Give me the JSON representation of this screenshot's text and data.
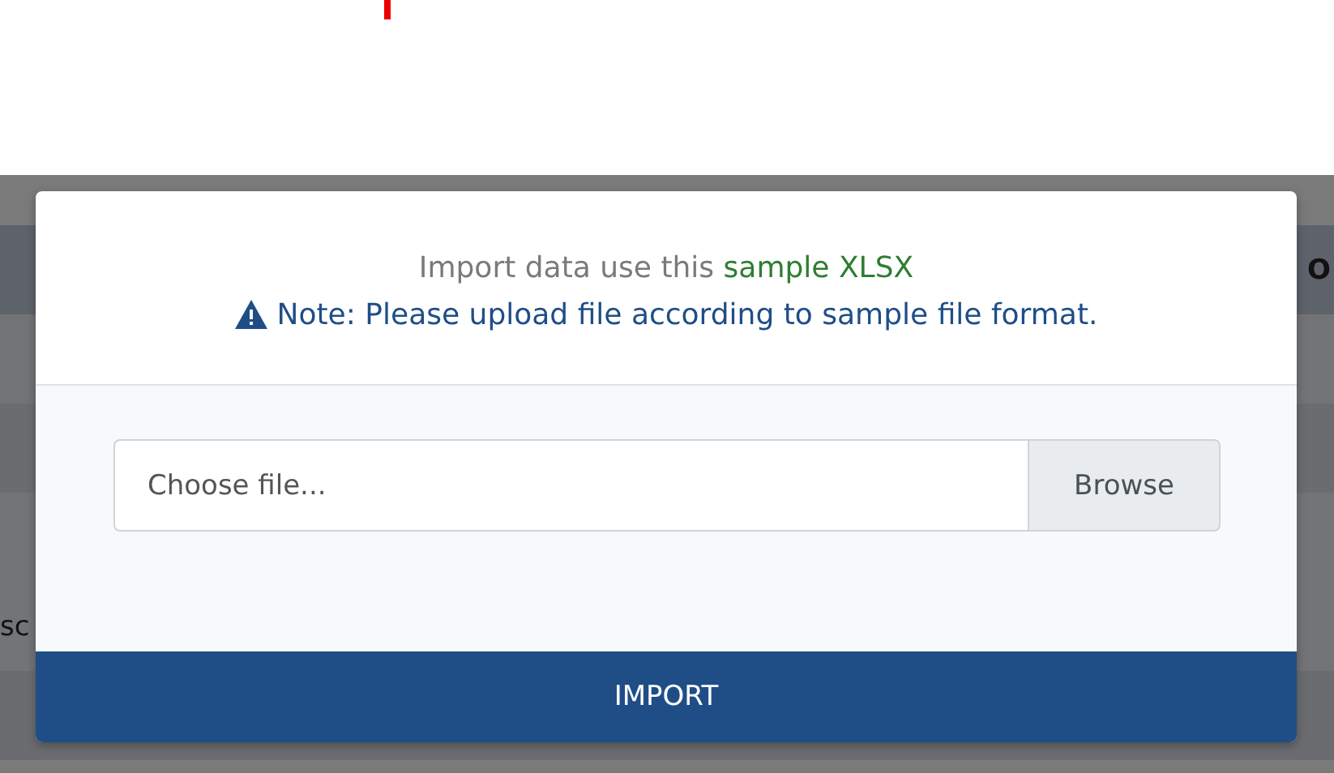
{
  "background_table": {
    "header_text": "O",
    "row_text": "sc"
  },
  "dialog": {
    "intro_text": "Import data use this",
    "sample_link": "sample XLSX",
    "note": "Note: Please upload file according to sample file format.",
    "file_input": {
      "placeholder": "Choose file..."
    },
    "browse_button": "Browse",
    "import_button": "IMPORT"
  }
}
